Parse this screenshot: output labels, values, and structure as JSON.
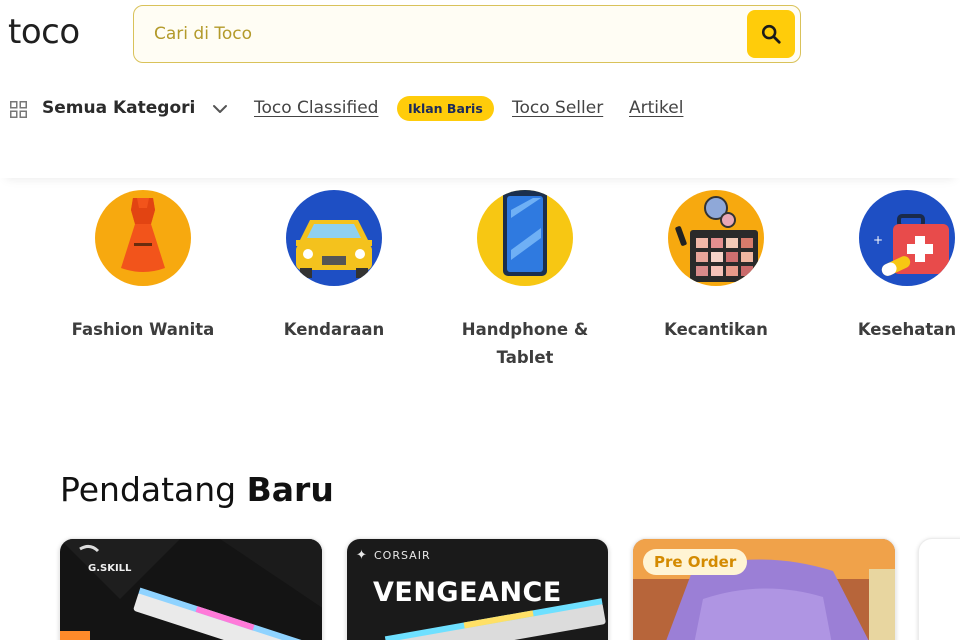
{
  "header": {
    "logo": "toco",
    "search": {
      "placeholder": "Cari di Toco"
    }
  },
  "nav": {
    "category_menu": "Semua Kategori",
    "links": [
      {
        "label": "Toco Classified"
      },
      {
        "label": "Toco Seller"
      },
      {
        "label": "Artikel"
      }
    ],
    "badge": "Iklan Baris"
  },
  "categories": [
    {
      "name": "Fashion Wanita",
      "icon": "dress-icon"
    },
    {
      "name": "Kendaraan",
      "icon": "car-icon"
    },
    {
      "name": "Handphone & Tablet",
      "icon": "smartphone-icon"
    },
    {
      "name": "Kecantikan",
      "icon": "makeup-palette-icon"
    },
    {
      "name": "Kesehatan",
      "icon": "first-aid-kit-icon"
    }
  ],
  "section": {
    "title_light": "Pendatang",
    "title_bold": "Baru"
  },
  "products": [
    {
      "brand": "G.SKILL"
    },
    {
      "brand": "CORSAIR",
      "title": "VENGEANCE"
    },
    {
      "tag": "Pre Order"
    }
  ],
  "colors": {
    "accent": "#ffcc0a",
    "badge_text": "#1c2a5a",
    "preorder_text": "#d48a00"
  }
}
